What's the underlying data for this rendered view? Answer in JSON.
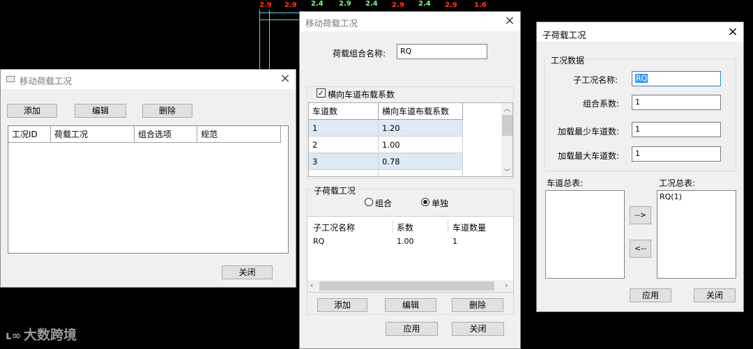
{
  "background": {
    "cad_labels": [
      "2.9",
      "2.9",
      "2.4",
      "2.9",
      "2.4",
      "2.9",
      "2.4",
      "2.9",
      "1.6"
    ],
    "watermark": "大数跨境"
  },
  "win1": {
    "title": "移动荷载工况",
    "buttons": {
      "add": "添加",
      "edit": "编辑",
      "delete": "删除",
      "close": "关闭"
    },
    "columns": [
      "工况ID",
      "荷载工况",
      "组合选项",
      "规范"
    ]
  },
  "win2": {
    "title": "移动荷载工况",
    "combo_name_label": "荷载组合名称:",
    "combo_name_value": "RQ",
    "lane_factor_checkbox": "横向车道布载系数",
    "lane_table": {
      "columns": [
        "车道数",
        "横向车道布载系数"
      ],
      "rows": [
        {
          "lanes": "1",
          "factor": "1.20"
        },
        {
          "lanes": "2",
          "factor": "1.00"
        },
        {
          "lanes": "3",
          "factor": "0.78"
        }
      ]
    },
    "sub_load_group": "子荷载工况",
    "radio_combine": "组合",
    "radio_single": "单独",
    "sub_table": {
      "columns": [
        "子工况名称",
        "系数",
        "车道数量"
      ],
      "rows": [
        {
          "name": "RQ",
          "coef": "1.00",
          "lanes": "1"
        }
      ]
    },
    "buttons": {
      "add": "添加",
      "edit": "编辑",
      "delete": "删除",
      "apply": "应用",
      "close": "关闭"
    }
  },
  "win3": {
    "title": "子荷载工况",
    "group_title": "工况数据",
    "fields": {
      "sub_name_label": "子工况名称:",
      "sub_name_value": "RQ",
      "coef_label": "组合系数:",
      "coef_value": "1",
      "min_lanes_label": "加载最少车道数:",
      "min_lanes_value": "1",
      "max_lanes_label": "加载最大车道数:",
      "max_lanes_value": "1"
    },
    "lane_list_label": "车道总表:",
    "case_list_label": "工况总表:",
    "case_list_items": [
      "RQ(1)"
    ],
    "move_right": "-->",
    "move_left": "<--",
    "buttons": {
      "apply": "应用",
      "close": "关闭"
    }
  }
}
